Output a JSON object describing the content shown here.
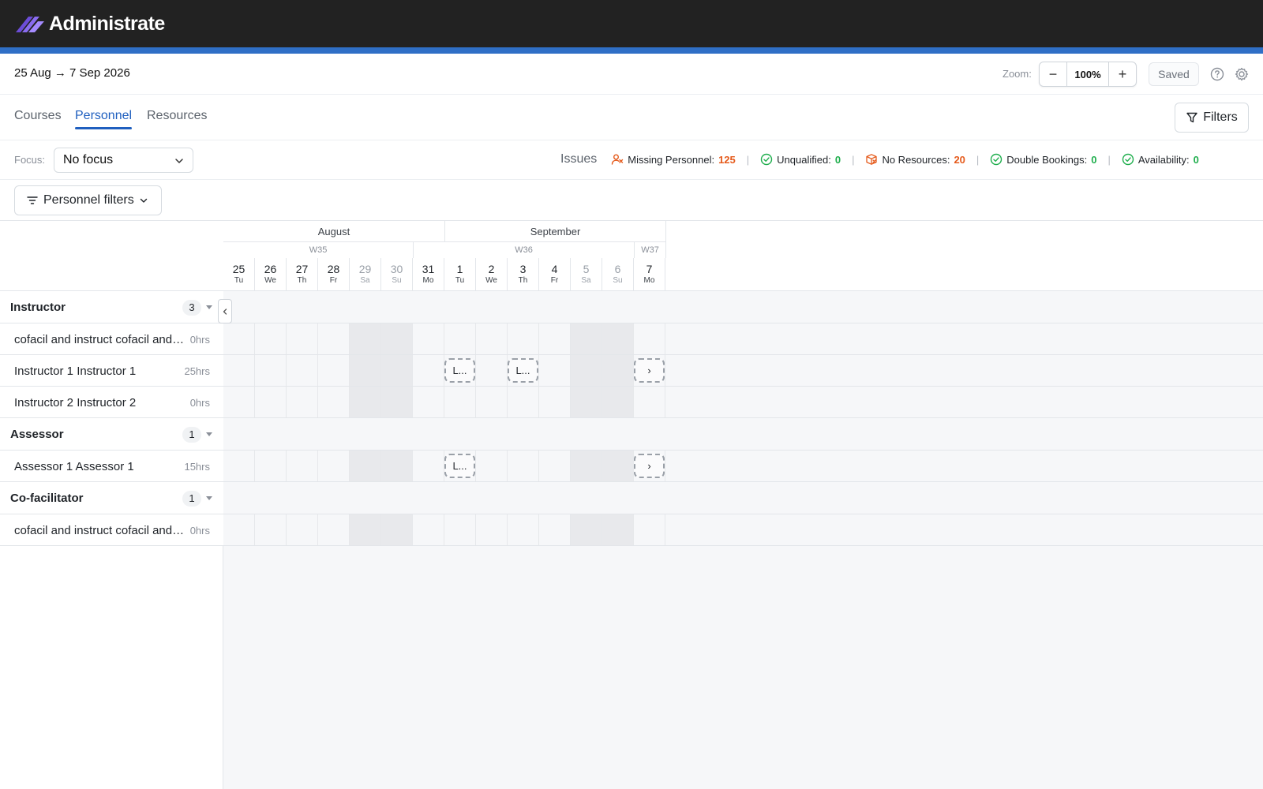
{
  "app": {
    "brand": "Administrate"
  },
  "colors": {
    "accent": "#2f6fc6",
    "tab_active": "#1f5fbf",
    "warning": "#e55a1b",
    "ok": "#1fae4d"
  },
  "toolbar": {
    "date_range": "25 Aug → 7 Sep 2026",
    "zoom_label": "Zoom:",
    "zoom_value": "100%",
    "zoom_out": "−",
    "zoom_in": "+",
    "saved_label": "Saved"
  },
  "tabs": [
    {
      "label": "Courses",
      "active": false
    },
    {
      "label": "Personnel",
      "active": true
    },
    {
      "label": "Resources",
      "active": false
    }
  ],
  "filters_label": "Filters",
  "focus": {
    "label": "Focus:",
    "value": "No focus"
  },
  "issues": {
    "title": "Issues",
    "items": [
      {
        "label": "Missing Personnel:",
        "count": "125",
        "status": "warning",
        "icon": "user-missing-icon"
      },
      {
        "label": "Unqualified:",
        "count": "0",
        "status": "ok",
        "icon": "check-circle-icon"
      },
      {
        "label": "No Resources:",
        "count": "20",
        "status": "warning",
        "icon": "box-missing-icon"
      },
      {
        "label": "Double Bookings:",
        "count": "0",
        "status": "ok",
        "icon": "check-circle-icon"
      },
      {
        "label": "Availability:",
        "count": "0",
        "status": "ok",
        "icon": "check-circle-icon"
      }
    ],
    "separator": "|"
  },
  "personnel_filters_label": "Personnel filters",
  "calendar": {
    "months": [
      {
        "label": "August"
      },
      {
        "label": "September"
      }
    ],
    "weeks": [
      {
        "label": "W35"
      },
      {
        "label": "W36"
      },
      {
        "label": "W37"
      }
    ],
    "days": [
      {
        "num": "25",
        "name": "Tu"
      },
      {
        "num": "26",
        "name": "We"
      },
      {
        "num": "27",
        "name": "Th"
      },
      {
        "num": "28",
        "name": "Fr"
      },
      {
        "num": "29",
        "name": "Sa"
      },
      {
        "num": "30",
        "name": "Su"
      },
      {
        "num": "31",
        "name": "Mo"
      },
      {
        "num": "1",
        "name": "Tu"
      },
      {
        "num": "2",
        "name": "We"
      },
      {
        "num": "3",
        "name": "Th"
      },
      {
        "num": "4",
        "name": "Fr"
      },
      {
        "num": "5",
        "name": "Sa"
      },
      {
        "num": "6",
        "name": "Su"
      },
      {
        "num": "7",
        "name": "Mo"
      }
    ]
  },
  "rows": [
    {
      "type": "group",
      "label": "Instructor",
      "count": "3"
    },
    {
      "type": "person",
      "label": "cofacil and instruct cofacil and instruct",
      "hours": "0hrs"
    },
    {
      "type": "person",
      "label": "Instructor 1 Instructor 1",
      "hours": "25hrs"
    },
    {
      "type": "person",
      "label": "Instructor 2 Instructor 2",
      "hours": "0hrs"
    },
    {
      "type": "group",
      "label": "Assessor",
      "count": "1"
    },
    {
      "type": "person",
      "label": "Assessor 1 Assessor 1",
      "hours": "15hrs"
    },
    {
      "type": "group",
      "label": "Co-facilitator",
      "count": "1"
    },
    {
      "type": "person",
      "label": "cofacil and instruct cofacil and instruct",
      "hours": "0hrs"
    }
  ],
  "events": [
    {
      "row": 2,
      "day": 7,
      "label": "L..."
    },
    {
      "row": 2,
      "day": 9,
      "label": "L..."
    },
    {
      "row": 2,
      "day": 13,
      "label": "›"
    },
    {
      "row": 5,
      "day": 7,
      "label": "L..."
    },
    {
      "row": 5,
      "day": 13,
      "label": "›"
    }
  ]
}
